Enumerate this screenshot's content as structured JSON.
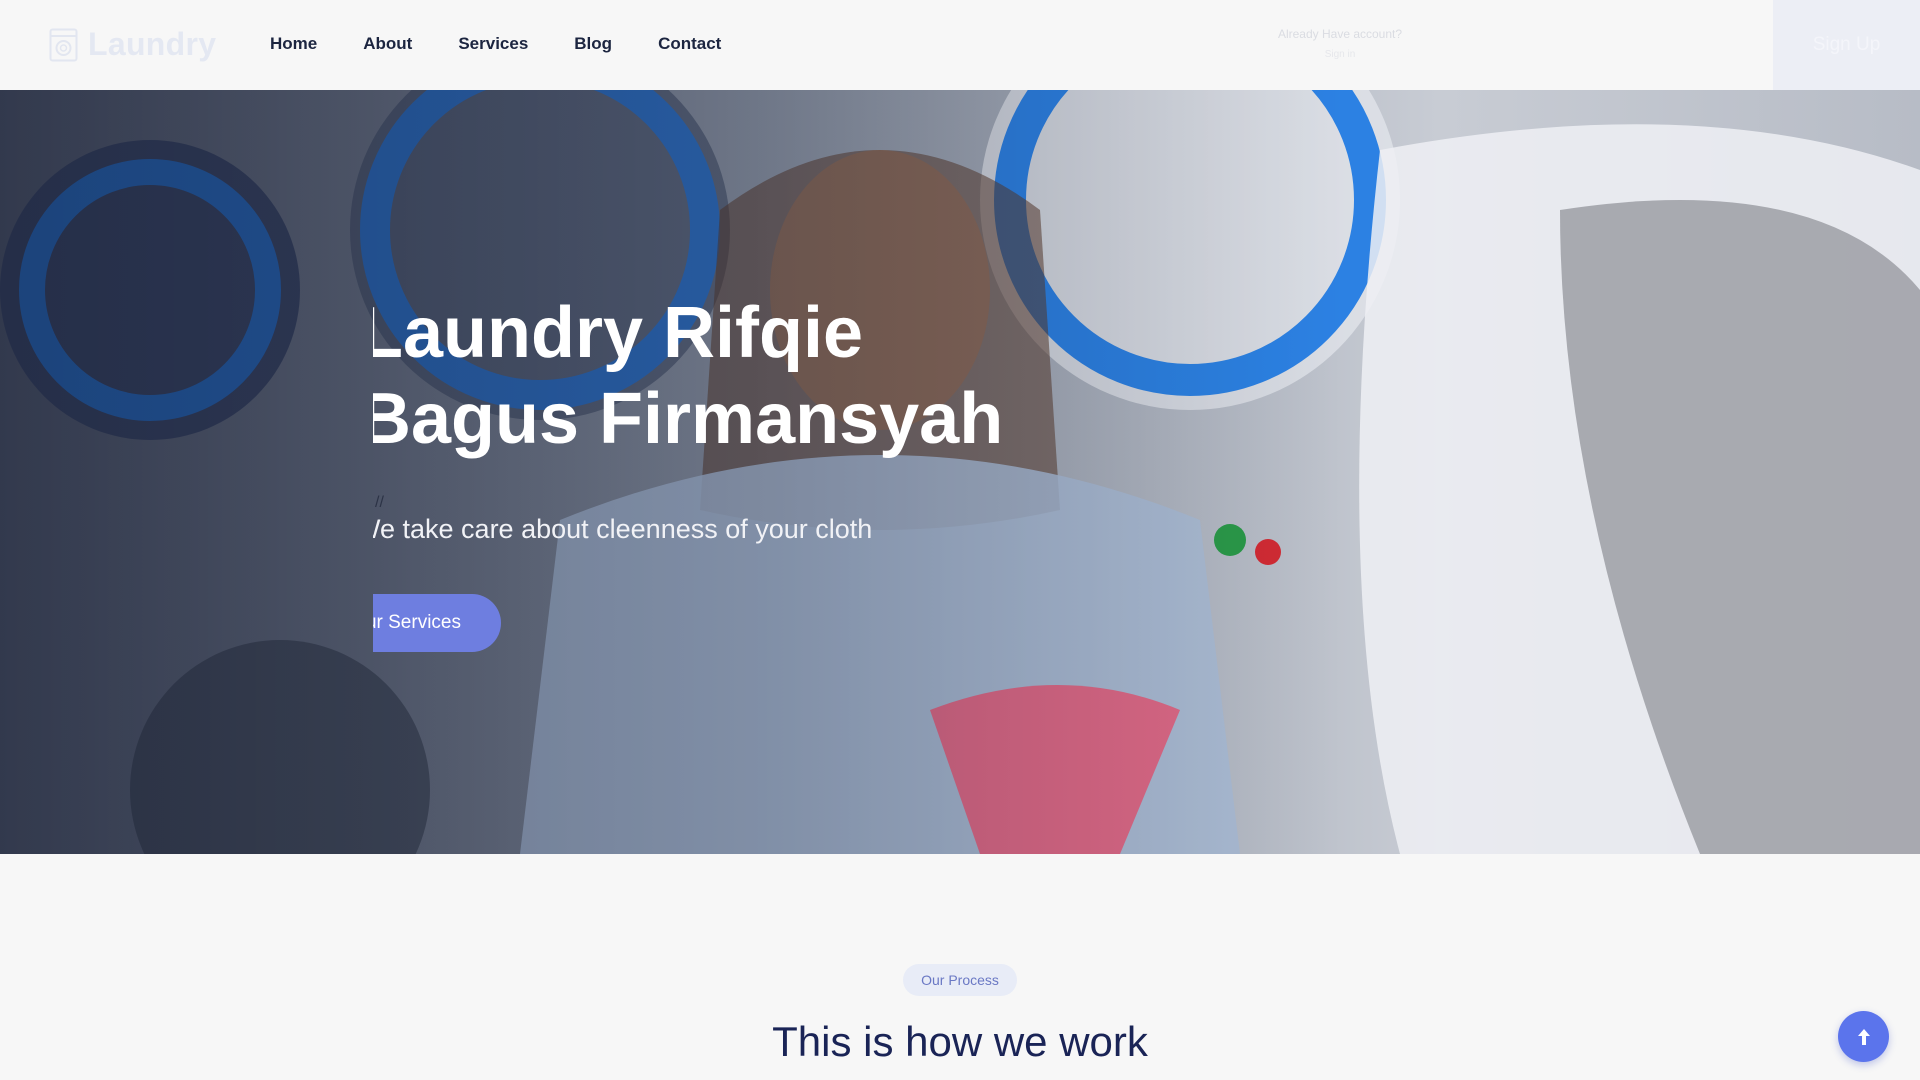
{
  "header": {
    "logo_text": "Laundry",
    "nav": [
      "Home",
      "About",
      "Services",
      "Blog",
      "Contact"
    ],
    "account_label": "Already Have account?",
    "account_link": "Sign in",
    "signup_label": "Sign Up"
  },
  "hero": {
    "title_line1": "Laundry Rifqie",
    "title_line2": "Bagus Firmansyah",
    "slash": "//",
    "subtitle": "We take care about cleenness of your cloth",
    "button_label": "Our Services"
  },
  "process": {
    "badge": "Our Process",
    "title": "This is how we work"
  },
  "colors": {
    "accent": "#5b74ec",
    "nav_text": "#1c2540",
    "heading": "#1a2456",
    "badge_bg": "#e8ecf7"
  },
  "icons": {
    "logo": "washing-machine-icon",
    "scroll_top": "arrow-up-icon"
  }
}
